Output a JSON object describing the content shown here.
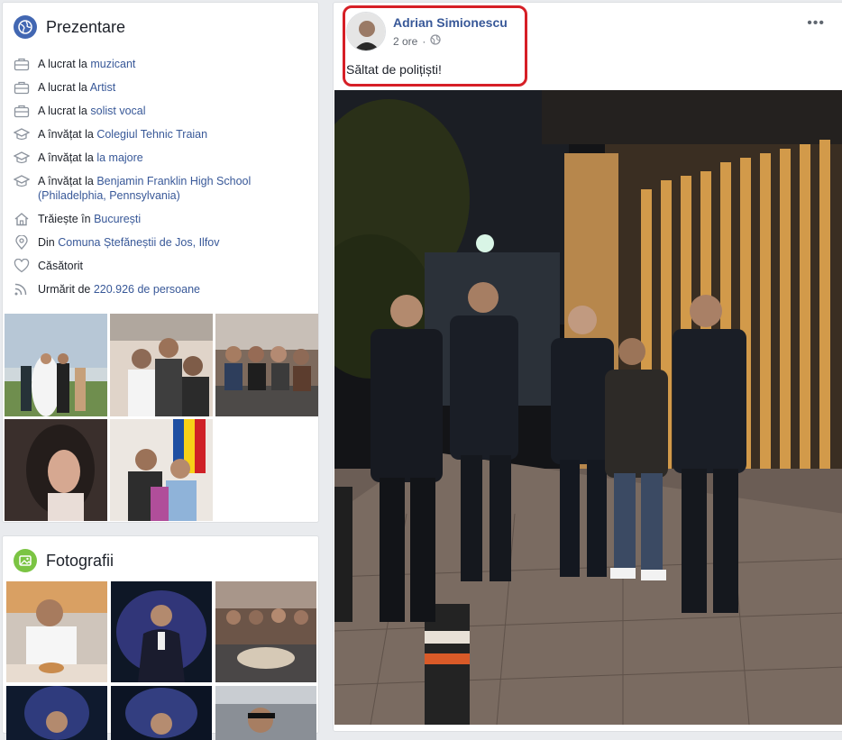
{
  "intro": {
    "title": "Prezentare",
    "items": [
      {
        "icon": "briefcase-icon",
        "prefix": "A lucrat la ",
        "link": "muzicant"
      },
      {
        "icon": "briefcase-icon",
        "prefix": "A lucrat la ",
        "link": "Artist"
      },
      {
        "icon": "briefcase-icon",
        "prefix": "A lucrat la ",
        "link": "solist vocal"
      },
      {
        "icon": "graduation-cap-icon",
        "prefix": "A învățat la ",
        "link": "Colegiul Tehnic Traian"
      },
      {
        "icon": "graduation-cap-icon",
        "prefix": "A învățat la ",
        "link": "la majore"
      },
      {
        "icon": "graduation-cap-icon",
        "prefix": "A învățat la ",
        "link": "Benjamin Franklin High School (Philadelphia, Pennsylvania)"
      },
      {
        "icon": "home-icon",
        "prefix": "Trăiește în ",
        "link": "București"
      },
      {
        "icon": "location-pin-icon",
        "prefix": "Din ",
        "link": "Comuna Ștefăneștii de Jos, Ilfov"
      },
      {
        "icon": "heart-icon",
        "prefix": "Căsătorit",
        "link": ""
      },
      {
        "icon": "rss-follow-icon",
        "prefix": "Urmărit de ",
        "link": "220.926 de persoane"
      }
    ]
  },
  "photos": {
    "title": "Fotografii"
  },
  "post": {
    "author": "Adrian Simionescu",
    "time": "2 ore",
    "dot": "·",
    "text": "Săltat de polițiști!",
    "more": "•••"
  },
  "colors": {
    "link": "#385898",
    "highlight": "#d61f26",
    "intro_icon_bg": "#1877f2",
    "photos_icon_bg": "#44bec7"
  }
}
